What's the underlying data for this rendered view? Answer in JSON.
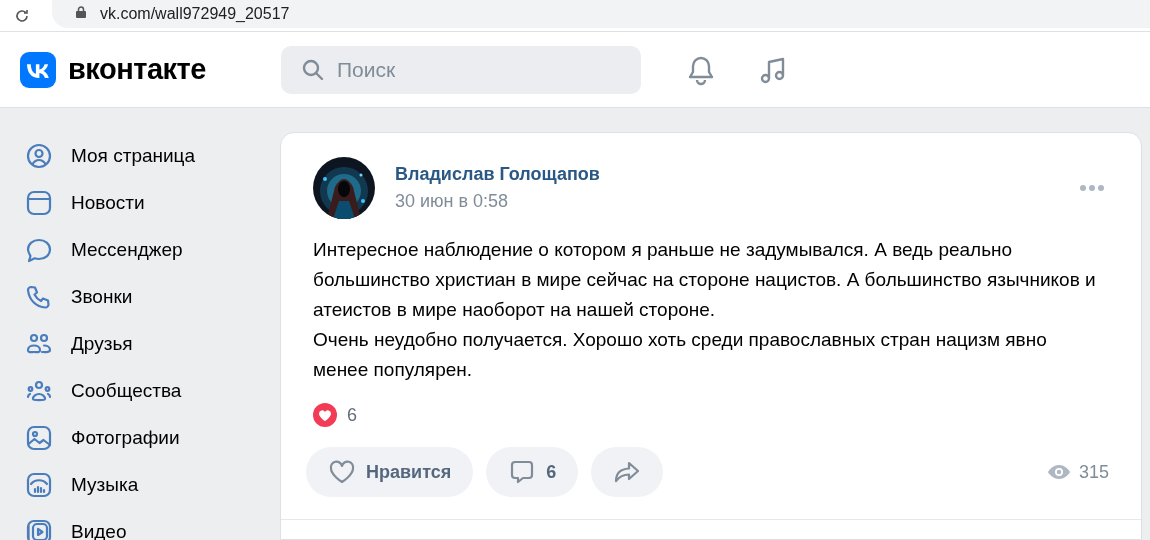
{
  "browser": {
    "url": "vk.com/wall972949_20517"
  },
  "header": {
    "logo": "вконтакте",
    "search": {
      "placeholder": "Поиск"
    }
  },
  "sidebar": {
    "items": [
      {
        "kind": "profile",
        "label": "Моя страница"
      },
      {
        "kind": "news",
        "label": "Новости"
      },
      {
        "kind": "messenger",
        "label": "Мессенджер"
      },
      {
        "kind": "calls",
        "label": "Звонки"
      },
      {
        "kind": "friends",
        "label": "Друзья"
      },
      {
        "kind": "communities",
        "label": "Сообщества"
      },
      {
        "kind": "photos",
        "label": "Фотографии"
      },
      {
        "kind": "music",
        "label": "Музыка"
      },
      {
        "kind": "video",
        "label": "Видео"
      }
    ]
  },
  "post": {
    "author": "Владислав Голощапов",
    "date": "30 июн в 0:58",
    "paragraphs": [
      "Интересное наблюдение о котором я раньше не задумывался. А ведь реально большинство христиан в мире сейчас на стороне нацистов. А большинство язычников и атеистов в мире наоборот на нашей стороне.",
      "Очень неудобно получается. Хорошо хоть среди православных стран нацизм явно менее популярен."
    ],
    "reactions": {
      "count": "6"
    },
    "actions": [
      {
        "kind": "like",
        "label": "Нравится"
      },
      {
        "kind": "comment",
        "label": "6"
      },
      {
        "kind": "share"
      }
    ],
    "views": "315"
  }
}
